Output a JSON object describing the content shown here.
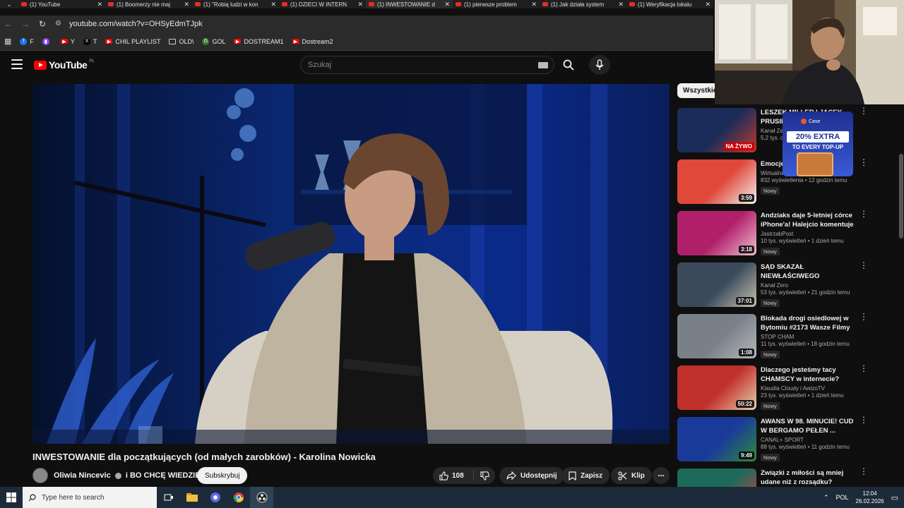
{
  "browser": {
    "tabs": [
      {
        "title": "(1) YouTube",
        "active": false
      },
      {
        "title": "(1) Boomerzy nie maj",
        "active": false
      },
      {
        "title": "(1) \"Robią ludzi w kon",
        "active": false
      },
      {
        "title": "(1) DZIECI W INTERN",
        "active": false
      },
      {
        "title": "(1) INWESTOWANIE d",
        "active": true
      },
      {
        "title": "(1) pierwsze problem",
        "active": false
      },
      {
        "title": "(1) Jak działa system",
        "active": false
      },
      {
        "title": "(1) Weryfikacja lokalu",
        "active": false
      }
    ],
    "url": "youtube.com/watch?v=OHSyEdmTJpk",
    "bookmarks": [
      {
        "label": "F",
        "icon": "facebook-icon",
        "color": "#1877f2"
      },
      {
        "label": "",
        "icon": "twitch-icon",
        "color": "#9146ff"
      },
      {
        "label": "Y",
        "icon": "youtube-icon",
        "color": "#ff0000"
      },
      {
        "label": "T",
        "icon": "x-icon",
        "color": "#000000"
      },
      {
        "label": "CHIL PLAYLIST",
        "icon": "youtube-icon",
        "color": "#ff0000"
      },
      {
        "label": "OLD\\",
        "icon": "folder-icon",
        "color": "#cccccc"
      },
      {
        "label": "GOL",
        "icon": "gol-icon",
        "color": "#2e7d32"
      },
      {
        "label": "DOSTREAM1",
        "icon": "youtube-icon",
        "color": "#ff0000"
      },
      {
        "label": "Dostream2",
        "icon": "youtube-icon",
        "color": "#ff0000"
      }
    ]
  },
  "youtube": {
    "logo_text": "YouTube",
    "country": "PL",
    "search_placeholder": "Szukaj",
    "video": {
      "title": "INWESTOWANIE dla początkujących (od małych zarobków) - Karolina Nowicka",
      "channel": "Oliwia Nincevic",
      "channel_joiner": "i",
      "channel2": "BO CHCĘ WIEDZIEĆ",
      "subscribe": "Subskrybuj",
      "likes": "108",
      "share": "Udostępnij",
      "save": "Zapisz",
      "clip": "Klip"
    },
    "chip": "Wszystkie",
    "recommendations": [
      {
        "title": "LESZEK MILLER I JACEK PRUSIN...",
        "channel": "Kanał Ze...",
        "meta": "5,2 tys. o...",
        "badge": "",
        "duration": "",
        "live": "NA ŻYWO",
        "thumb": [
          "#1b2c5a",
          "#c0392b"
        ]
      },
      {
        "title": "Emocje... Konfed...",
        "channel": "Wirtualna Polska",
        "meta": "832 wyświetlenia • 12 godzin temu",
        "badge": "Nowy",
        "duration": "3:59",
        "live": "",
        "thumb": [
          "#e0483a",
          "#f2f2f2"
        ]
      },
      {
        "title": "Andziaks daje 5-letniej córce iPhone'a! Halejcio komentuje",
        "channel": "JastrzabPost",
        "meta": "10 tys. wyświetleń • 1 dzień temu",
        "badge": "Nowy",
        "duration": "3:18",
        "live": "",
        "thumb": [
          "#b0206a",
          "#f0c0d0"
        ]
      },
      {
        "title": "SĄD SKAZAŁ NIEWŁAŚCIWEGO MĘŻCZYZNĘ? RPO WNOSI O ...",
        "channel": "Kanał Zero",
        "meta": "53 tys. wyświetleń • 21 godzin temu",
        "badge": "Nowy",
        "duration": "37:01",
        "live": "",
        "thumb": [
          "#3a4a5a",
          "#c9c0b0"
        ]
      },
      {
        "title": "Blokada drogi osiedlowej w Bytomiu #2173 Wasze Filmy",
        "channel": "STOP CHAM",
        "meta": "11 tys. wyświetleń • 18 godzin temu",
        "badge": "Nowy",
        "duration": "1:08",
        "live": "",
        "thumb": [
          "#7a8088",
          "#b5b9bc"
        ]
      },
      {
        "title": "Dlaczego jesteśmy tacy CHAMSCY w internecie?",
        "channel": "Klaudia Cloudy i AwizoTV",
        "meta": "23 tys. wyświetleń • 1 dzień temu",
        "badge": "Nowy",
        "duration": "50:22",
        "live": "",
        "thumb": [
          "#c0302a",
          "#e8d0b0"
        ]
      },
      {
        "title": "AWANS W 98. MINUCIE! CUD W BERGAMO PEŁEN ...",
        "channel": "CANAL+ SPORT",
        "meta": "88 tys. wyświetleń • 11 godzin temu",
        "badge": "Nowy",
        "duration": "9:49",
        "live": "",
        "thumb": [
          "#1a3a9a",
          "#2e8b3a"
        ]
      },
      {
        "title": "Związki z miłości są mniej udane niż z rozsądku?",
        "channel": "Nie wiem, ale się dowiem!",
        "meta": "",
        "badge": "",
        "duration": "",
        "live": "",
        "thumb": [
          "#1e6a5a",
          "#d04040"
        ]
      }
    ],
    "ad": {
      "brand": "Case",
      "headline": "20% EXTRA",
      "sub": "TO EVERY TOP-UP"
    }
  },
  "taskbar": {
    "search_placeholder": "Type here to search",
    "language": "POL",
    "time": "12:04",
    "date": "26.02.2026"
  }
}
